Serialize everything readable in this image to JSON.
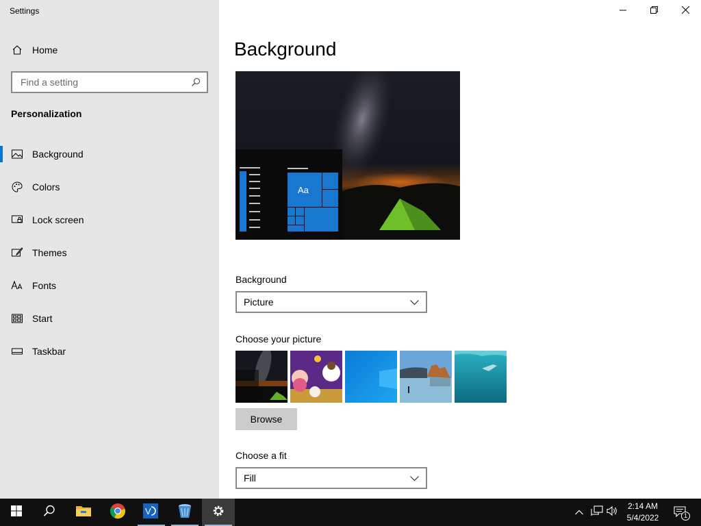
{
  "window": {
    "title": "Settings",
    "controls": [
      "minimize-icon",
      "restore-icon",
      "close-icon"
    ]
  },
  "sidebar": {
    "home_label": "Home",
    "search_placeholder": "Find a setting",
    "section_title": "Personalization",
    "items": [
      {
        "label": "Background",
        "icon": "picture-icon",
        "active": true
      },
      {
        "label": "Colors",
        "icon": "palette-icon",
        "active": false
      },
      {
        "label": "Lock screen",
        "icon": "lock-screen-icon",
        "active": false
      },
      {
        "label": "Themes",
        "icon": "themes-icon",
        "active": false
      },
      {
        "label": "Fonts",
        "icon": "fonts-icon",
        "active": false
      },
      {
        "label": "Start",
        "icon": "start-icon",
        "active": false
      },
      {
        "label": "Taskbar",
        "icon": "taskbar-icon",
        "active": false
      }
    ]
  },
  "main": {
    "title": "Background",
    "preview_tile_text": "Aa",
    "background_label": "Background",
    "background_value": "Picture",
    "choose_picture_label": "Choose your picture",
    "pictures": [
      "milky-way-tent",
      "cartoon-characters",
      "windows-blue",
      "beach-rocks",
      "underwater-swimmer"
    ],
    "browse_label": "Browse",
    "fit_label": "Choose a fit",
    "fit_value": "Fill"
  },
  "taskbar": {
    "apps": [
      "start-icon",
      "search-icon",
      "file-explorer-icon",
      "chrome-icon",
      "vmware-icon",
      "recycle-bin-icon",
      "settings-icon"
    ],
    "time": "2:14 AM",
    "date": "5/4/2022",
    "notification_count": "1"
  },
  "colors": {
    "accent": "#0078d4",
    "sidebar_bg": "#e6e6e6",
    "taskbar_bg": "#101010"
  }
}
